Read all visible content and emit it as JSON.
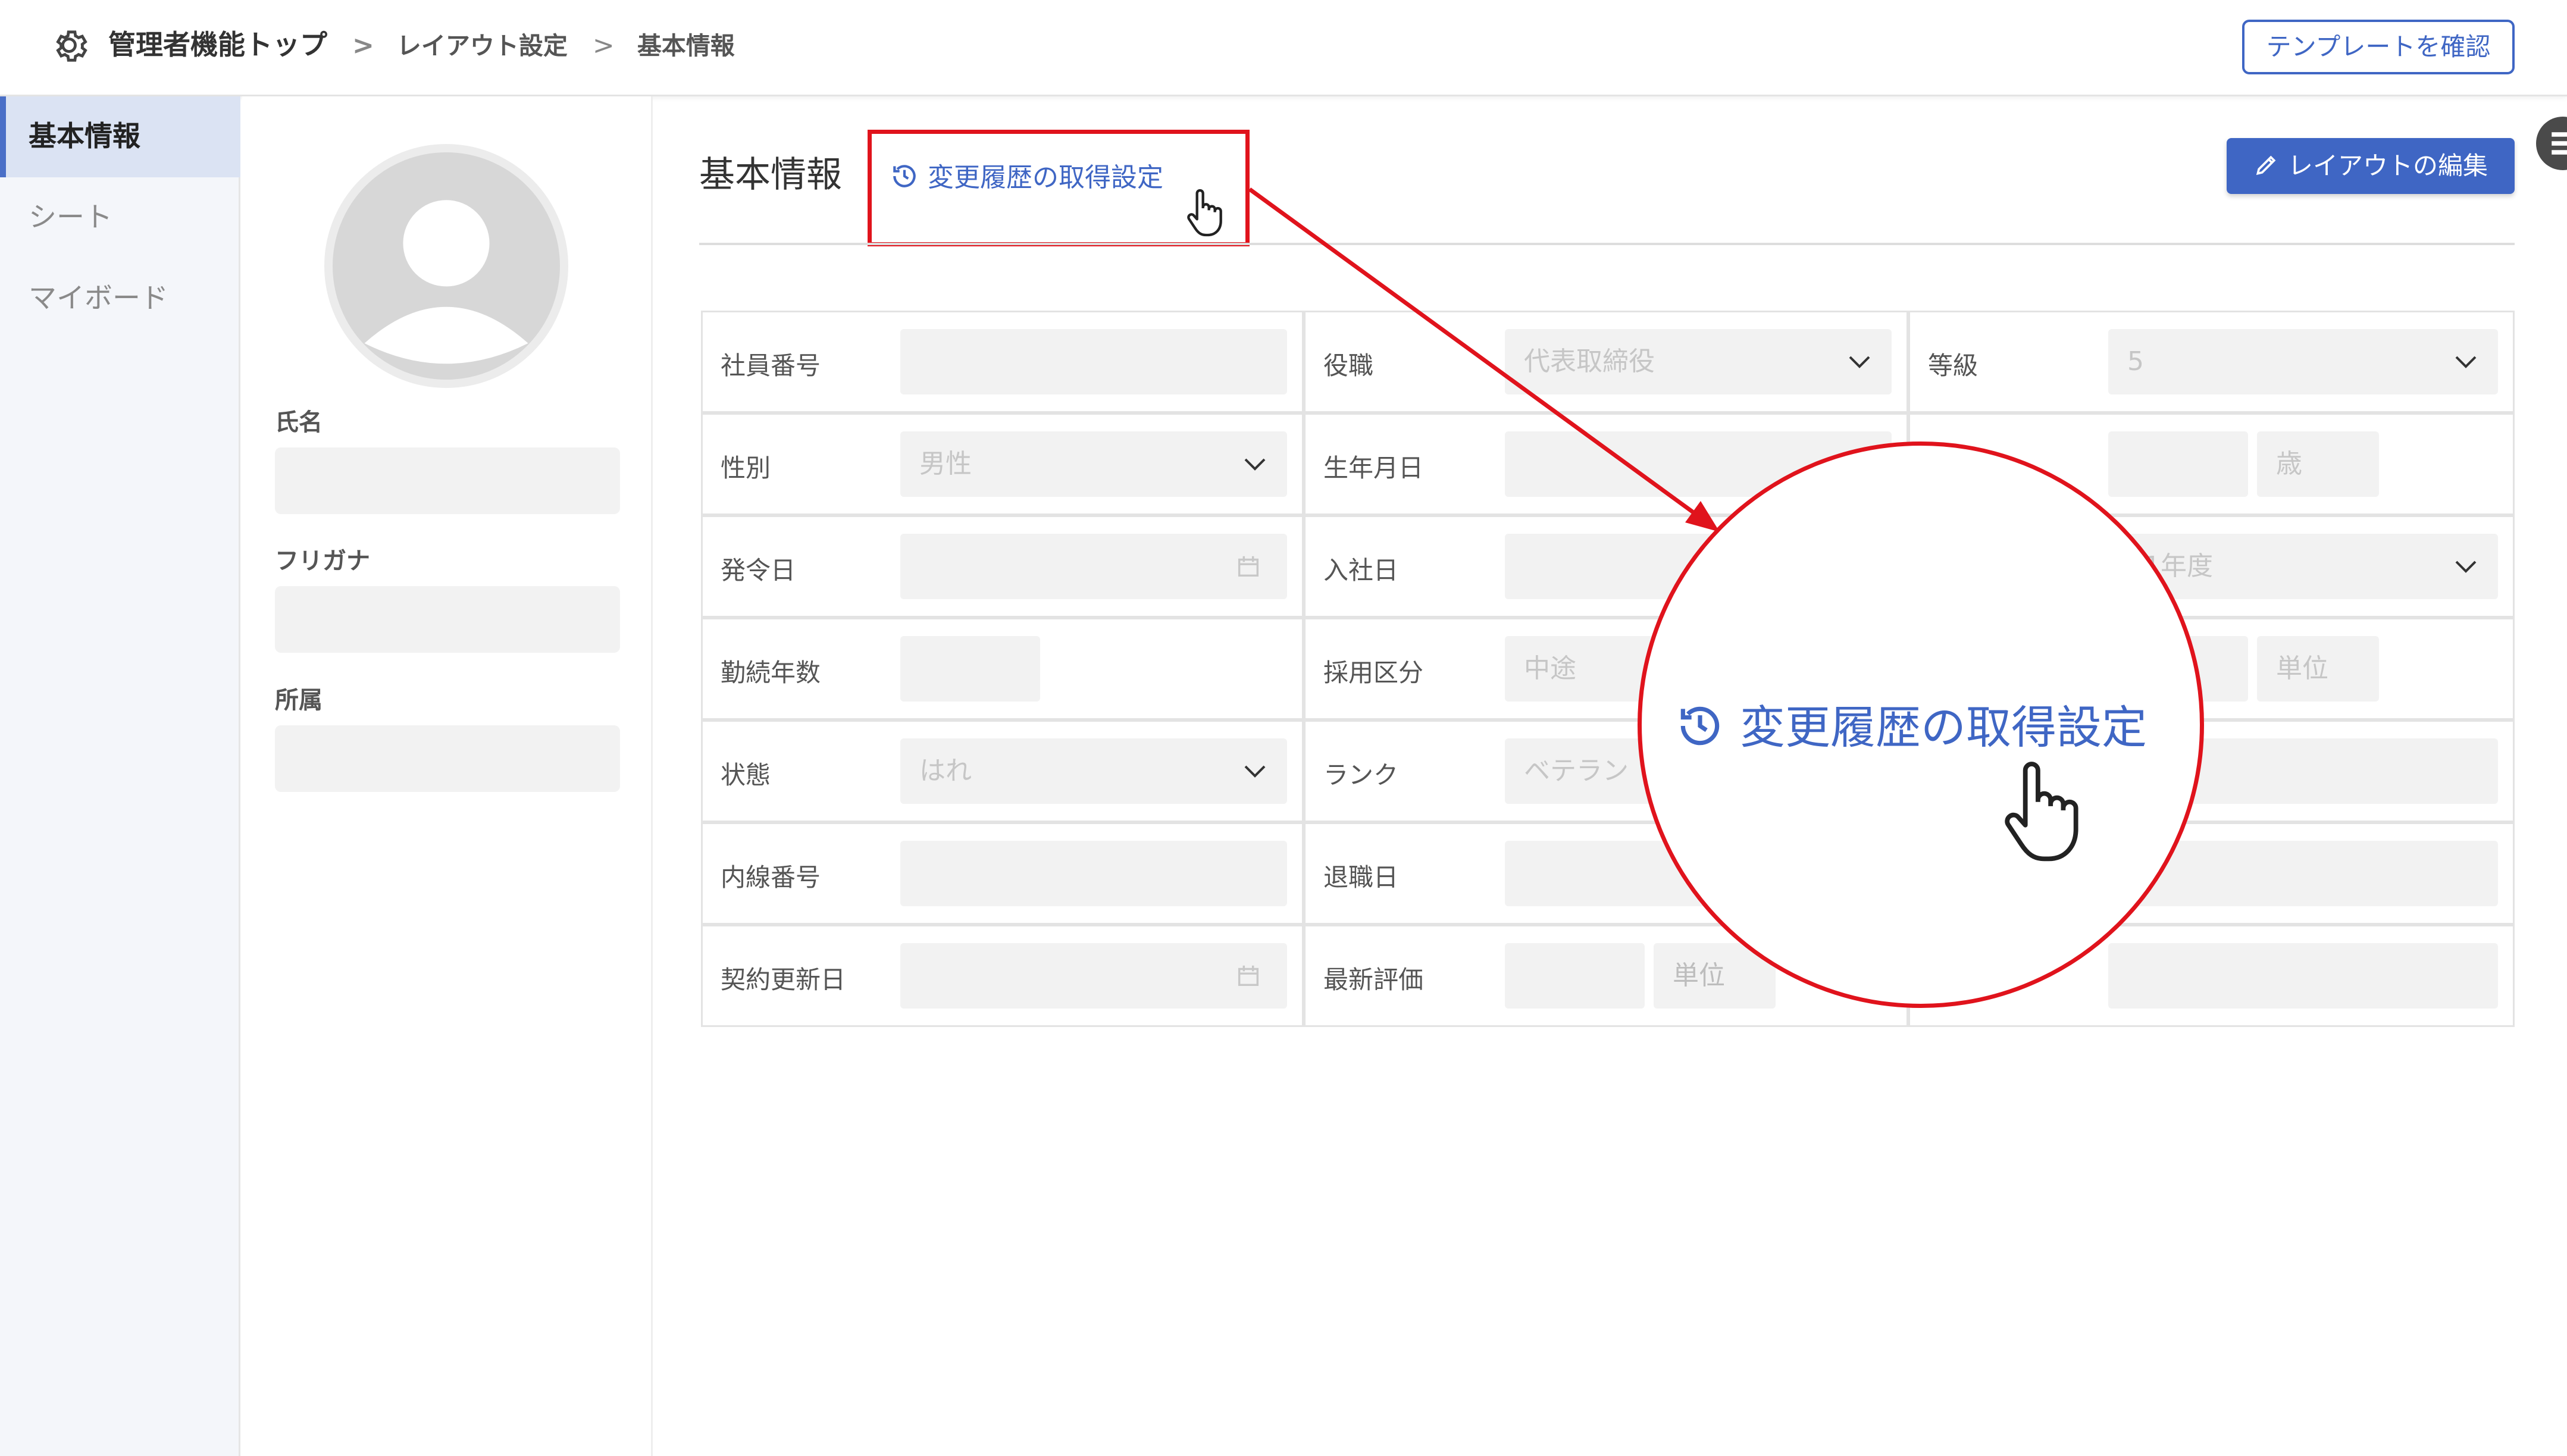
{
  "header": {
    "breadcrumb_top": "管理者機能トップ",
    "breadcrumb_sep": ">",
    "breadcrumb_layout": "レイアウト設定",
    "breadcrumb_current": "基本情報",
    "template_button": "テンプレートを確認"
  },
  "nav": {
    "items": [
      {
        "label": "基本情報"
      },
      {
        "label": "シート"
      },
      {
        "label": "マイボード"
      }
    ]
  },
  "profile": {
    "name_label": "氏名",
    "furigana_label": "フリガナ",
    "dept_label": "所属"
  },
  "section": {
    "title": "基本情報",
    "history_link": "変更履歴の取得設定",
    "edit_button": "レイアウトの編集"
  },
  "form": {
    "employee_no": "社員番号",
    "position": "役職",
    "position_value": "代表取締役",
    "grade": "等級",
    "grade_value": "5",
    "gender": "性別",
    "gender_value": "男性",
    "birthdate": "生年月日",
    "age_unit": "歳",
    "issue_date": "発令日",
    "hire_date": "入社日",
    "fiscal_year_value": "81年度",
    "tenure": "勤続年数",
    "hire_type": "採用区分",
    "hire_type_value": "中途",
    "unit_placeholder": "単位",
    "status": "状態",
    "status_value": "はれ",
    "rank": "ランク",
    "rank_value": "ベテラン",
    "extension": "内線番号",
    "retire_date": "退職日",
    "contract_renewal": "契約更新日",
    "latest_eval": "最新評価",
    "unit_placeholder2": "単位"
  },
  "zoom": {
    "text": "変更履歴の取得設定"
  },
  "colors": {
    "accent": "#3f66c4",
    "highlight": "#e0131c"
  }
}
